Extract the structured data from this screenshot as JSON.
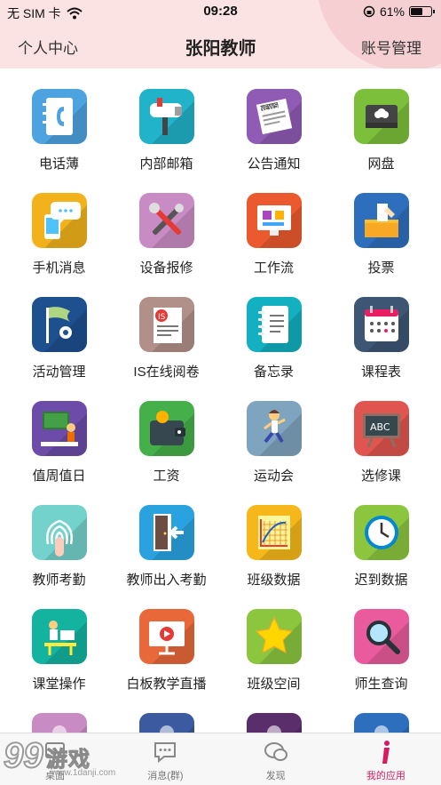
{
  "status_bar": {
    "carrier": "无 SIM 卡",
    "time": "09:28",
    "battery_percent": "61%",
    "battery_level": 0.61,
    "icons": [
      "wifi-icon",
      "rotation-lock-icon",
      "battery-icon"
    ]
  },
  "nav": {
    "left": "个人中心",
    "title": "张阳教师",
    "right": "账号管理",
    "background": "#fbe3e3"
  },
  "apps": [
    {
      "label": "电话薄",
      "icon": "phonebook-icon",
      "color": "#4da3e0"
    },
    {
      "label": "内部邮箱",
      "icon": "mailbox-icon",
      "color": "#21b3c9"
    },
    {
      "label": "公告通知",
      "icon": "newspaper-icon",
      "color": "#8f5bb5"
    },
    {
      "label": "网盘",
      "icon": "cloud-drive-icon",
      "color": "#7cbf3a"
    },
    {
      "label": "手机消息",
      "icon": "mobile-message-icon",
      "color": "#f2b21b"
    },
    {
      "label": "设备报修",
      "icon": "repair-tools-icon",
      "color": "#c98bc4"
    },
    {
      "label": "工作流",
      "icon": "workflow-icon",
      "color": "#ea5a2e"
    },
    {
      "label": "投票",
      "icon": "vote-box-icon",
      "color": "#2d6fbd"
    },
    {
      "label": "活动管理",
      "icon": "flag-gear-icon",
      "color": "#1e4f8f"
    },
    {
      "label": "IS在线阅卷",
      "icon": "online-marking-icon",
      "color": "#b09088"
    },
    {
      "label": "备忘录",
      "icon": "notebook-icon",
      "color": "#12b0c0"
    },
    {
      "label": "课程表",
      "icon": "calendar-icon",
      "color": "#3d5673"
    },
    {
      "label": "值周值日",
      "icon": "duty-teacher-icon",
      "color": "#6c4ca8"
    },
    {
      "label": "工资",
      "icon": "wallet-icon",
      "color": "#45b04a"
    },
    {
      "label": "运动会",
      "icon": "running-boy-icon",
      "color": "#7fa4bf"
    },
    {
      "label": "选修课",
      "icon": "blackboard-abc-icon",
      "color": "#e0554f"
    },
    {
      "label": "教师考勤",
      "icon": "fingerprint-icon",
      "color": "#74d2cc"
    },
    {
      "label": "教师出入考勤",
      "icon": "door-exit-icon",
      "color": "#2aa2e0"
    },
    {
      "label": "班级数据",
      "icon": "chart-grid-icon",
      "color": "#f5b71a"
    },
    {
      "label": "迟到数据",
      "icon": "clock-icon",
      "color": "#8cc63f"
    },
    {
      "label": "课堂操作",
      "icon": "student-desk-icon",
      "color": "#14b3a0"
    },
    {
      "label": "白板教学直播",
      "icon": "whiteboard-play-icon",
      "color": "#e9683a"
    },
    {
      "label": "班级空间",
      "icon": "star-icon",
      "color": "#8cc63f"
    },
    {
      "label": "师生查询",
      "icon": "magnifier-icon",
      "color": "#e95b9c"
    },
    {
      "label": "",
      "icon": "partial-app-icon",
      "color": "#c98bc4"
    },
    {
      "label": "",
      "icon": "partial-app-icon",
      "color": "#3b5aa0"
    },
    {
      "label": "",
      "icon": "partial-app-icon",
      "color": "#5a2e6a"
    },
    {
      "label": "",
      "icon": "partial-app-icon",
      "color": "#2d6fbd"
    }
  ],
  "tabbar": {
    "tabs": [
      {
        "label": "桌面",
        "icon": "desktop-icon",
        "active": false
      },
      {
        "label": "消息(群)",
        "icon": "message-bubble-icon",
        "active": false
      },
      {
        "label": "发现",
        "icon": "discover-chat-icon",
        "active": false
      },
      {
        "label": "我的应用",
        "icon": "info-i-icon",
        "active": true
      }
    ],
    "active_color": "#d81b60"
  },
  "watermark": {
    "number": "9",
    "text": "游戏",
    "url": "1danji.com"
  }
}
